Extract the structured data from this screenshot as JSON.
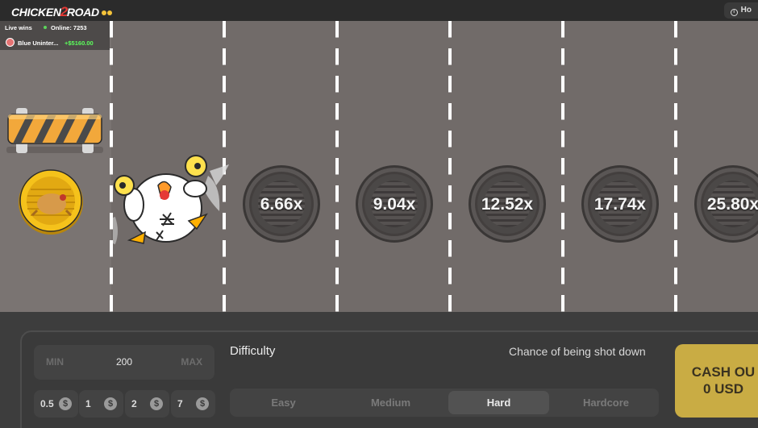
{
  "header": {
    "logo_word1": "CHICKEN",
    "logo_number": "2",
    "logo_word2": "ROAD",
    "howto_label": "Ho"
  },
  "live_wins": {
    "title": "Live wins",
    "online": "Online: 7253",
    "entries": [
      {
        "user": "Blue Uninter...",
        "amount": "+$5160.00"
      }
    ]
  },
  "lanes": [
    {
      "multiplier": "6.66x"
    },
    {
      "multiplier": "9.04x"
    },
    {
      "multiplier": "12.52x"
    },
    {
      "multiplier": "17.74x"
    },
    {
      "multiplier": "25.80x"
    }
  ],
  "bet": {
    "min_label": "MIN",
    "value": "200",
    "max_label": "MAX",
    "quick_amounts": [
      "0.5",
      "1",
      "2",
      "7"
    ],
    "currency_symbol": "$"
  },
  "difficulty": {
    "label": "Difficulty",
    "chance_label": "Chance of being shot down",
    "options": [
      "Easy",
      "Medium",
      "Hard",
      "Hardcore"
    ],
    "selected": "Hard"
  },
  "cashout": {
    "line1": "CASH OU",
    "line2": "0 USD"
  },
  "colors": {
    "road": "#716b69",
    "accent_gold": "#c9ac44",
    "win_green": "#5cff5c",
    "logo_red": "#e53935"
  }
}
